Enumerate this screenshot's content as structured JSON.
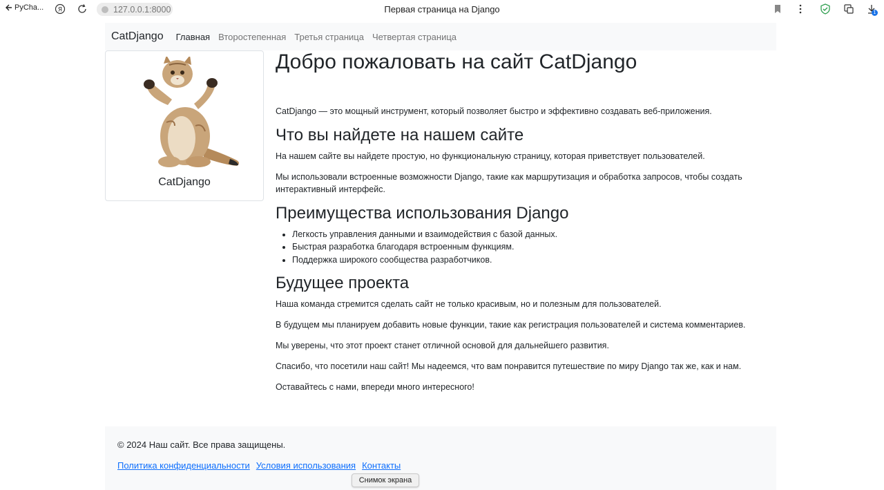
{
  "browser": {
    "back_label": "PyCha...",
    "url": "127.0.0.1:8000",
    "tab_title": "Первая страница на Django",
    "download_badge": "1"
  },
  "nav": {
    "brand": "CatDjango",
    "links": [
      "Главная",
      "Второстепенная",
      "Третья страница",
      "Четвертая страница"
    ]
  },
  "card": {
    "title": "CatDjango"
  },
  "main": {
    "title": "Добро пожаловать на сайт CatDjango",
    "intro": "CatDjango — это мощный инструмент, который позволяет быстро и эффективно создавать веб-приложения.",
    "section1": {
      "heading": "Что вы найдете на нашем сайте",
      "p1": "На нашем сайте вы найдете простую, но функциональную страницу, которая приветствует пользователей.",
      "p2": "Мы использовали встроенные возможности Django, такие как маршрутизация и обработка запросов, чтобы создать интерактивный интерфейс."
    },
    "section2": {
      "heading": "Преимущества использования Django",
      "items": [
        "Легкость управления данными и взаимодействия с базой данных.",
        "Быстрая разработка благодаря встроенным функциям.",
        "Поддержка широкого сообщества разработчиков."
      ]
    },
    "section3": {
      "heading": "Будущее проекта",
      "p1": "Наша команда стремится сделать сайт не только красивым, но и полезным для пользователей.",
      "p2": "В будущем мы планируем добавить новые функции, такие как регистрация пользователей и система комментариев.",
      "p3": "Мы уверены, что этот проект станет отличной основой для дальнейшего развития.",
      "p4": "Спасибо, что посетили наш сайт! Мы надеемся, что вам понравится путешествие по миру Django так же, как и нам.",
      "p5": "Оставайтесь с нами, впереди много интересного!"
    }
  },
  "footer": {
    "copyright": "© 2024 Наш сайт. Все права защищены.",
    "links": [
      "Политика конфиденциальности",
      "Условия использования",
      "Контакты"
    ]
  },
  "tooltip": "Снимок экрана",
  "colors": {
    "link": "#0d6efd",
    "navbar_bg": "#f8f9fa",
    "text": "#212529"
  }
}
